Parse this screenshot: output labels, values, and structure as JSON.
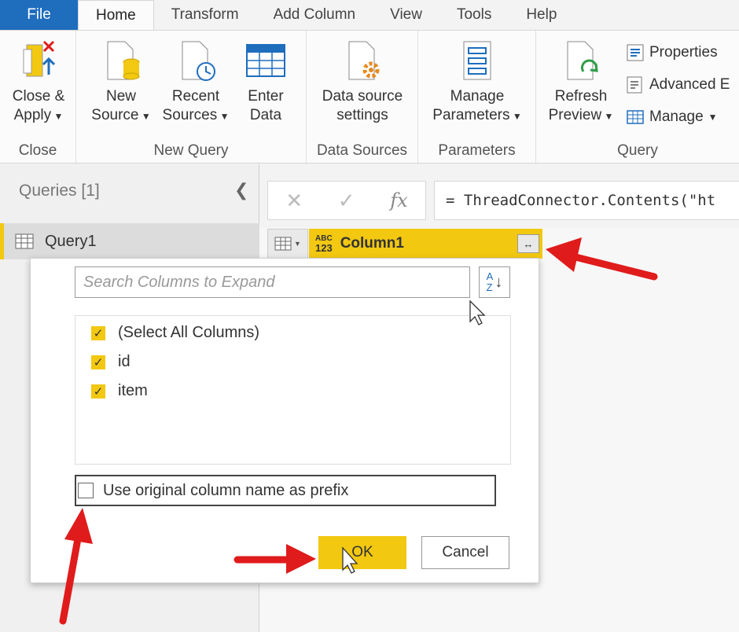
{
  "tabs": {
    "file": "File",
    "items": [
      "Home",
      "Transform",
      "Add Column",
      "View",
      "Tools",
      "Help"
    ]
  },
  "ribbon": {
    "close": {
      "line1": "Close &",
      "line2": "Apply",
      "group": "Close"
    },
    "new_query": {
      "group": "New Query",
      "new_source": [
        "New",
        "Source"
      ],
      "recent_sources": [
        "Recent",
        "Sources"
      ],
      "enter_data": [
        "Enter",
        "Data"
      ]
    },
    "data_sources": {
      "group": "Data Sources",
      "settings": [
        "Data source",
        "settings"
      ]
    },
    "parameters": {
      "group": "Parameters",
      "manage": [
        "Manage",
        "Parameters"
      ]
    },
    "query": {
      "group": "Query",
      "refresh": [
        "Refresh",
        "Preview"
      ],
      "properties": "Properties",
      "advanced": "Advanced E",
      "manage": "Manage"
    }
  },
  "queries": {
    "title": "Queries [1]",
    "items": [
      "Query1"
    ]
  },
  "formula": {
    "fx": "fx",
    "text": "= ThreadConnector.Contents(\"ht"
  },
  "column": {
    "type_top": "ABC",
    "type_bottom": "123",
    "name": "Column1"
  },
  "dialog": {
    "search_placeholder": "Search Columns to Expand",
    "sort_icon_top": "A",
    "sort_icon_bottom": "Z",
    "columns": [
      "(Select All Columns)",
      "id",
      "item"
    ],
    "prefix_label": "Use original column name as prefix",
    "ok": "OK",
    "cancel": "Cancel"
  },
  "colors": {
    "accent": "#f2c811",
    "file_tab": "#1f6dbd",
    "arrow": "#e01b1b"
  }
}
